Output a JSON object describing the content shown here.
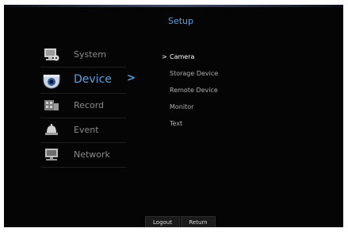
{
  "header": {
    "title": "Setup"
  },
  "sidebar": {
    "items": [
      {
        "label": "System",
        "icon": "system-icon"
      },
      {
        "label": "Device",
        "icon": "camera-icon",
        "active": true
      },
      {
        "label": "Record",
        "icon": "record-icon"
      },
      {
        "label": "Event",
        "icon": "event-icon"
      },
      {
        "label": "Network",
        "icon": "network-icon"
      }
    ],
    "active_arrow": ">"
  },
  "submenu": {
    "chevron": ">",
    "items": [
      {
        "label": "Camera",
        "selected": true
      },
      {
        "label": "Storage Device"
      },
      {
        "label": "Remote Device"
      },
      {
        "label": "Monitor"
      },
      {
        "label": "Text"
      }
    ]
  },
  "footer": {
    "logout_label": "Logout",
    "return_label": "Return"
  },
  "colors": {
    "accent": "#5aa0dc",
    "background": "#050505",
    "inactive_text": "#8a8a8a"
  }
}
